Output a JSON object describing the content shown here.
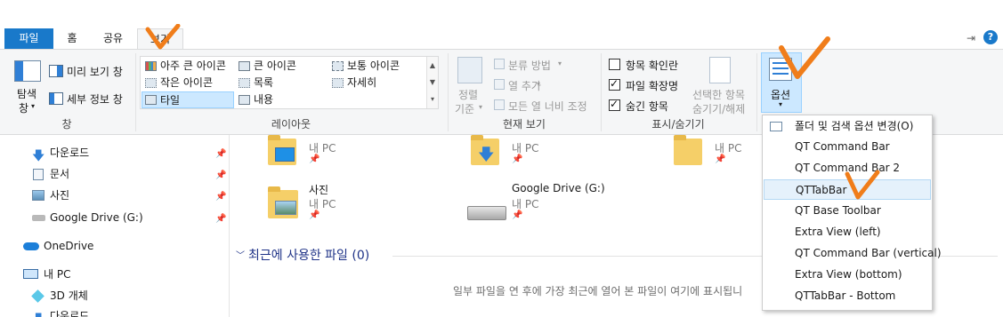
{
  "tabs": {
    "file": "파일",
    "home": "홈",
    "share": "공유",
    "view": "보기"
  },
  "ribbon": {
    "pane_group": {
      "nav_pane_line1": "탐색",
      "nav_pane_line2": "창",
      "preview": "미리 보기 창",
      "details": "세부 정보 창",
      "label": "창"
    },
    "layout_group": {
      "items": [
        "아주 큰 아이콘",
        "큰 아이콘",
        "보통 아이콘",
        "작은 아이콘",
        "목록",
        "자세히",
        "타일",
        "내용"
      ],
      "label": "레이아웃"
    },
    "current_view_group": {
      "sort_line1": "정렬",
      "sort_line2": "기준",
      "group_by": "분류 방법",
      "add_columns": "열 추가",
      "size_columns": "모든 열 너비 조정",
      "label": "현재 보기"
    },
    "show_hide_group": {
      "item_checkboxes": "항목 확인란",
      "item_checkboxes_checked": false,
      "file_extensions": "파일 확장명",
      "file_extensions_checked": true,
      "hidden_items": "숨긴 항목",
      "hidden_items_checked": true,
      "hide_selected_line1": "선택한 항목",
      "hide_selected_line2": "숨기기/해제",
      "label": "표시/숨기기"
    },
    "options_button": "옵션"
  },
  "options_menu": {
    "items": [
      "폴더 및 검색 옵션 변경(O)",
      "QT Command Bar",
      "QT Command Bar 2",
      "QTTabBar",
      "QT Base Toolbar",
      "Extra View (left)",
      "QT Command Bar (vertical)",
      "Extra View (bottom)",
      "QTTabBar - Bottom"
    ],
    "highlighted_index": 3
  },
  "nav": {
    "items": [
      "다운로드",
      "문서",
      "사진",
      "Google Drive (G:)",
      "OneDrive",
      "내 PC",
      "3D 개체",
      "다운로드"
    ]
  },
  "content": {
    "tiles": [
      {
        "name": "사진",
        "sub": "내 PC"
      },
      {
        "name": "Google Drive (G:)",
        "sub": "내 PC"
      }
    ],
    "top_sub": [
      "내 PC",
      "내 PC",
      "내 PC"
    ],
    "recent_header": "최근에 사용한 파일 (0)",
    "recent_empty": "일부 파일을 연 후에 가장 최근에 열어 본 파일이 여기에 표시됩니"
  },
  "colors": {
    "accent_blue": "#1979ca",
    "annotation_orange": "#f07d1a",
    "highlight": "#e5f1fb"
  }
}
